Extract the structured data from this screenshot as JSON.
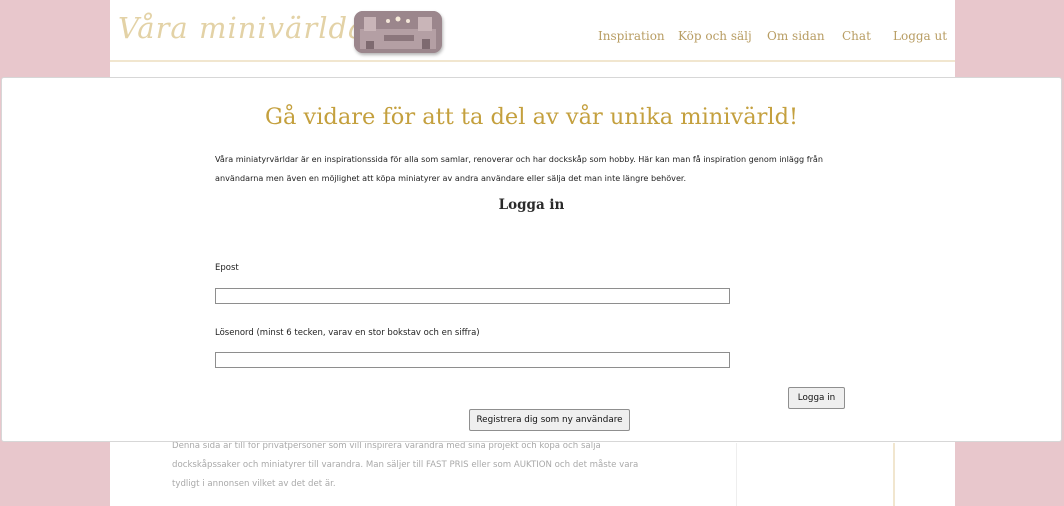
{
  "header": {
    "logo_text": "Våra minivärldar",
    "nav": [
      "Inspiration",
      "Köp och sälj",
      "Om sidan",
      "Chat",
      "Logga ut"
    ]
  },
  "background": {
    "body_text": "Denna sida är till för privatpersoner som vill inspirera varandra med sina projekt och köpa och sälja dockskåpssaker och miniatyrer till varandra. Man säljer till FAST PRIS eller som AUKTION och det måste vara tydligt i annonsen vilket av det det är."
  },
  "modal": {
    "title": "Gå vidare för att ta del av vår unika minivärld!",
    "intro": "Våra miniatyrvärldar är en inspirationssida för alla som samlar, renoverar och har dockskåp som hobby. Här kan man få inspiration genom inlägg från användarna men även en möjlighet att köpa miniatyrer av andra användare eller sälja det man inte längre behöver.",
    "login_heading": "Logga in",
    "email_label": "Epost",
    "email_value": "",
    "password_label": "Lösenord (minst 6 tecken, varav en stor bokstav och en siffra)",
    "password_value": "",
    "login_button": "Logga in",
    "register_button": "Registrera dig som ny användare"
  }
}
